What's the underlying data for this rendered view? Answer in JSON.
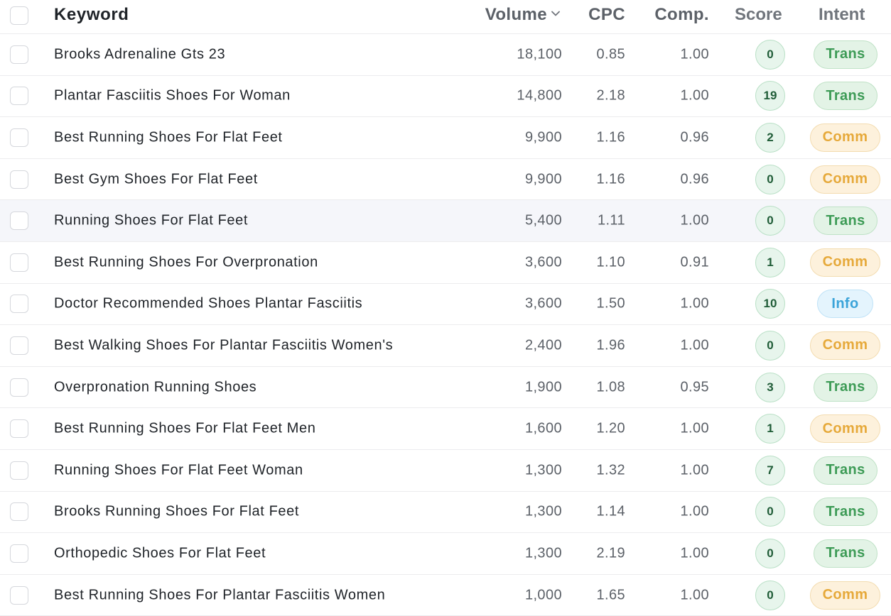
{
  "headers": {
    "keyword": "Keyword",
    "volume": "Volume",
    "cpc": "CPC",
    "comp": "Comp.",
    "score": "Score",
    "intent": "Intent"
  },
  "sort": {
    "column": "volume",
    "direction": "desc",
    "icon": "chevron-down-icon"
  },
  "highlighted_row": 4,
  "colors": {
    "trans": "#3d9b56",
    "comm": "#e6a93a",
    "info": "#3aa3d9",
    "score": "#1f5c37"
  },
  "rows": [
    {
      "keyword": "Brooks Adrenaline Gts 23",
      "volume": "18,100",
      "cpc": "0.85",
      "comp": "1.00",
      "score": "0",
      "intent": "Trans"
    },
    {
      "keyword": "Plantar Fasciitis Shoes For Woman",
      "volume": "14,800",
      "cpc": "2.18",
      "comp": "1.00",
      "score": "19",
      "intent": "Trans"
    },
    {
      "keyword": "Best Running Shoes For Flat Feet",
      "volume": "9,900",
      "cpc": "1.16",
      "comp": "0.96",
      "score": "2",
      "intent": "Comm"
    },
    {
      "keyword": "Best Gym Shoes For Flat Feet",
      "volume": "9,900",
      "cpc": "1.16",
      "comp": "0.96",
      "score": "0",
      "intent": "Comm"
    },
    {
      "keyword": "Running Shoes For Flat Feet",
      "volume": "5,400",
      "cpc": "1.11",
      "comp": "1.00",
      "score": "0",
      "intent": "Trans"
    },
    {
      "keyword": "Best Running Shoes For Overpronation",
      "volume": "3,600",
      "cpc": "1.10",
      "comp": "0.91",
      "score": "1",
      "intent": "Comm"
    },
    {
      "keyword": "Doctor Recommended Shoes Plantar Fasciitis",
      "volume": "3,600",
      "cpc": "1.50",
      "comp": "1.00",
      "score": "10",
      "intent": "Info"
    },
    {
      "keyword": "Best Walking Shoes For Plantar Fasciitis Women's",
      "volume": "2,400",
      "cpc": "1.96",
      "comp": "1.00",
      "score": "0",
      "intent": "Comm"
    },
    {
      "keyword": "Overpronation Running Shoes",
      "volume": "1,900",
      "cpc": "1.08",
      "comp": "0.95",
      "score": "3",
      "intent": "Trans"
    },
    {
      "keyword": "Best Running Shoes For Flat Feet Men",
      "volume": "1,600",
      "cpc": "1.20",
      "comp": "1.00",
      "score": "1",
      "intent": "Comm"
    },
    {
      "keyword": "Running Shoes For Flat Feet Woman",
      "volume": "1,300",
      "cpc": "1.32",
      "comp": "1.00",
      "score": "7",
      "intent": "Trans"
    },
    {
      "keyword": "Brooks Running Shoes For Flat Feet",
      "volume": "1,300",
      "cpc": "1.14",
      "comp": "1.00",
      "score": "0",
      "intent": "Trans"
    },
    {
      "keyword": "Orthopedic Shoes For Flat Feet",
      "volume": "1,300",
      "cpc": "2.19",
      "comp": "1.00",
      "score": "0",
      "intent": "Trans"
    },
    {
      "keyword": "Best Running Shoes For Plantar Fasciitis Women",
      "volume": "1,000",
      "cpc": "1.65",
      "comp": "1.00",
      "score": "0",
      "intent": "Comm"
    }
  ]
}
